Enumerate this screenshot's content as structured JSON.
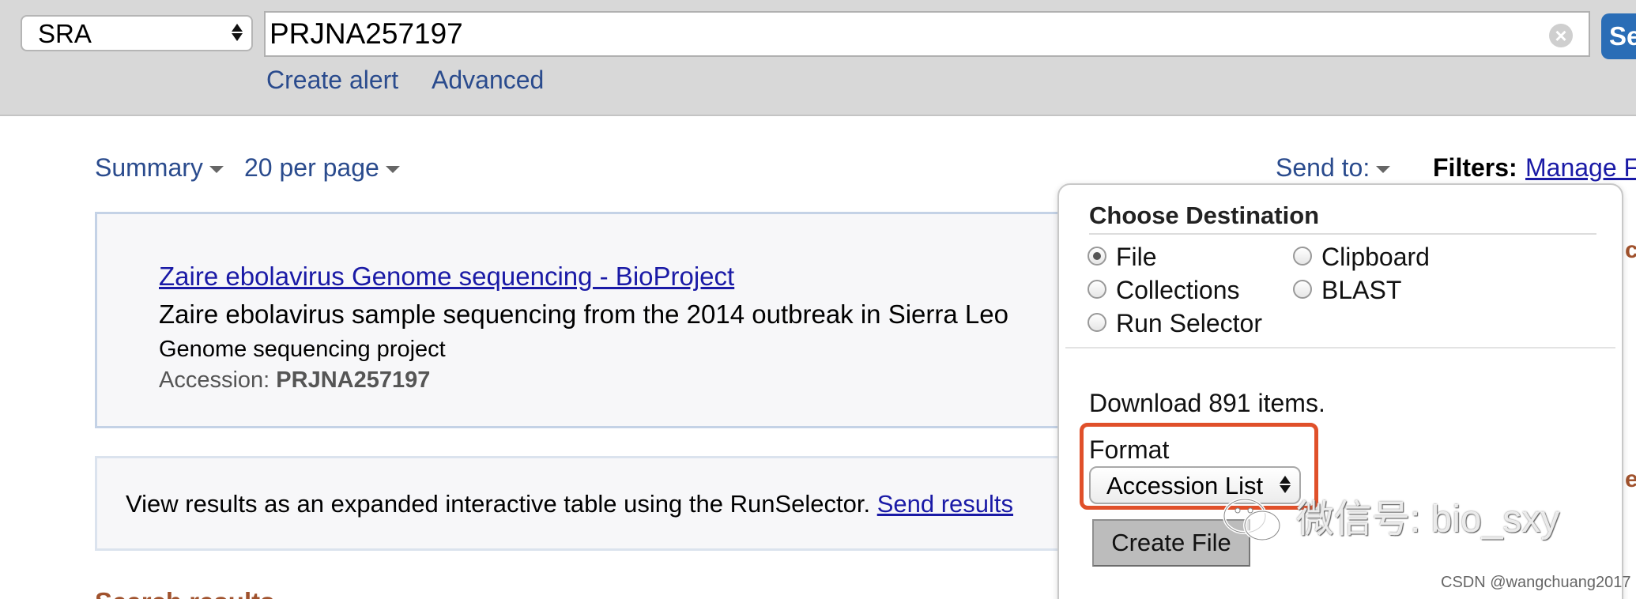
{
  "search": {
    "database": "SRA",
    "query": "PRJNA257197",
    "button_label": "Se",
    "links": [
      "Create alert",
      "Advanced"
    ]
  },
  "toolbar": {
    "summary_label": "Summary",
    "per_page_label": "20 per page",
    "send_to_label": "Send to:",
    "filters_label": "Filters:",
    "manage_filters_label": "Manage F"
  },
  "result": {
    "title": "Zaire ebolavirus Genome sequencing - BioProject",
    "description": "Zaire ebolavirus sample sequencing from the 2014 outbreak in Sierra Leo",
    "type": "Genome sequencing project",
    "accession_label": "Accession:",
    "accession_value": "PRJNA257197"
  },
  "runselector": {
    "text": "View results as an expanded interactive table using the RunSelector.",
    "link": "Send results"
  },
  "heading": "Search results",
  "popup": {
    "title": "Choose Destination",
    "options": [
      "File",
      "Clipboard",
      "Collections",
      "BLAST",
      "Run Selector"
    ],
    "selected_option": "File",
    "download_text": "Download 891 items.",
    "format_label": "Format",
    "format_value": "Accession List",
    "create_button": "Create File"
  },
  "watermark": {
    "wechat_text": "微信号: bio_sxy",
    "csdn_text": "CSDN @wangchuang2017"
  },
  "colors": {
    "link": "#2a4b8d",
    "highlight": "#e0502a",
    "search_button": "#2a6db6"
  }
}
